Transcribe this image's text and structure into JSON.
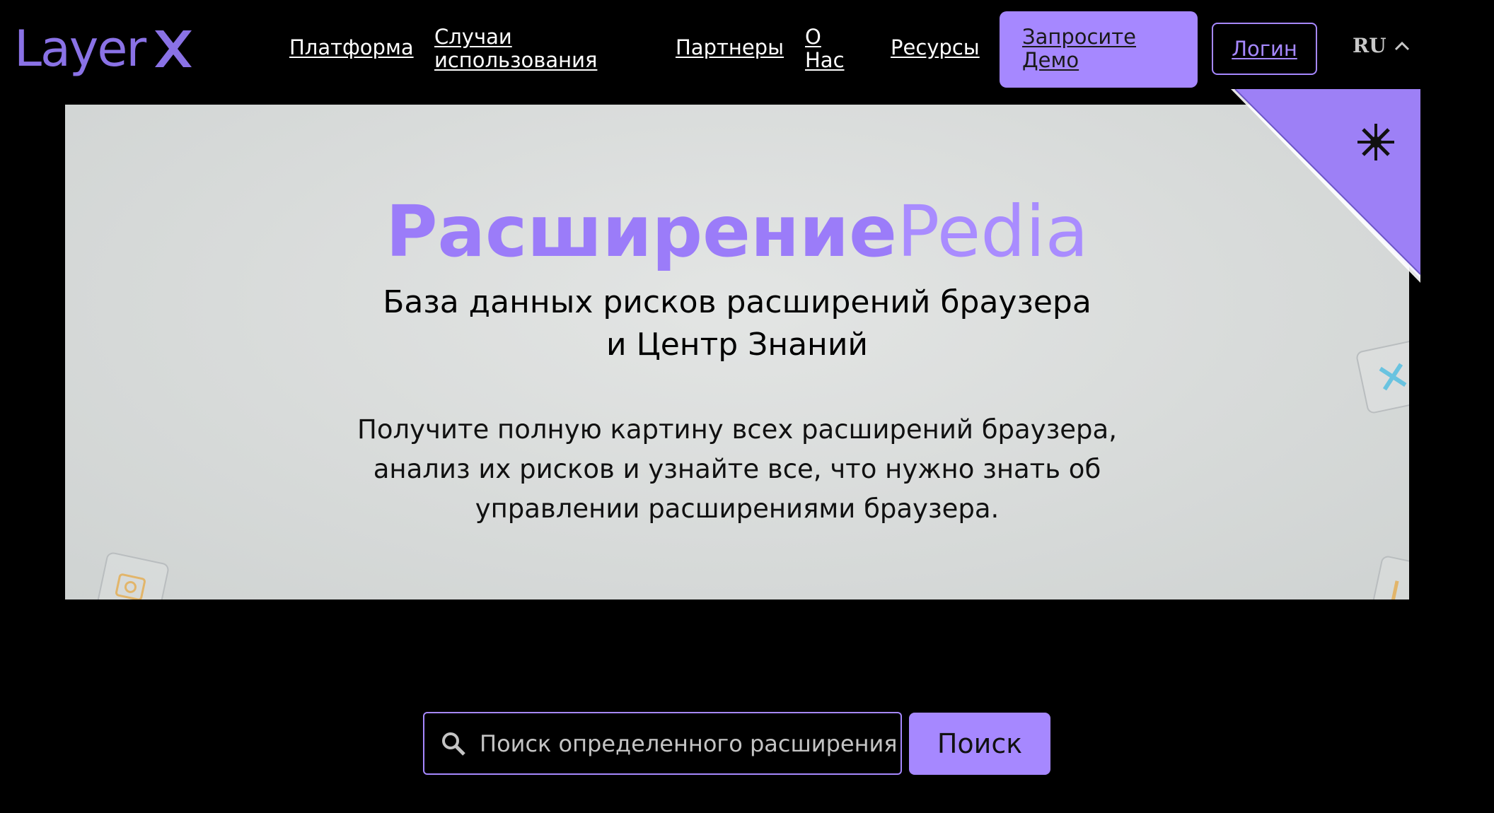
{
  "header": {
    "logo_text": "Layer",
    "nav": {
      "platform": "Платформа",
      "use_cases": "Случаи использования",
      "partners": "Партнеры",
      "about": "О Нас",
      "resources": "Ресурсы"
    },
    "demo_label": "Запросите Демо",
    "login_label": "Логин",
    "language": "RU"
  },
  "hero": {
    "title_bold": "Расширение",
    "title_light": "Pedia",
    "subtitle_line1": "База данных рисков расширений браузера",
    "subtitle_line2": "и Центр Знаний",
    "desc_line1": "Получите полную картину всех расширений браузера,",
    "desc_line2": "анализ их рисков и узнайте все, что нужно знать об",
    "desc_line3": "управлении расширениями браузера."
  },
  "search": {
    "placeholder": "Поиск определенного расширения",
    "button_label": "Поиск"
  },
  "colors": {
    "accent": "#a688ff",
    "background": "#000000",
    "hero_bg": "#d9dcdb"
  }
}
